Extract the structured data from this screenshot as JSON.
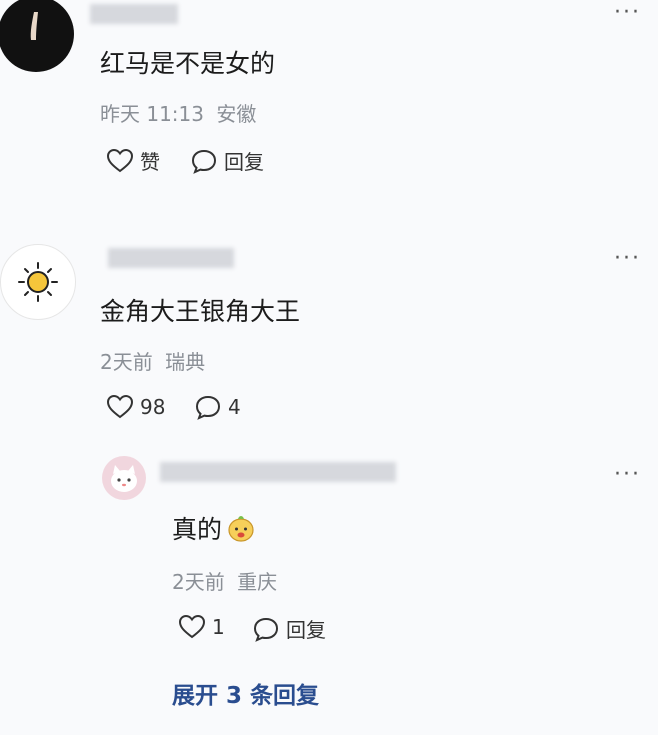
{
  "comments": [
    {
      "content": "红马是不是女的",
      "time": "昨天 11:13",
      "location": "安徽",
      "like_label": "赞",
      "reply_label": "回复"
    },
    {
      "content": "金角大王银角大王",
      "time": "2天前",
      "location": "瑞典",
      "like_count": "98",
      "reply_count": "4",
      "reply": {
        "content": "真的",
        "emoji": "hamster-emoji",
        "time": "2天前",
        "location": "重庆",
        "like_count": "1",
        "reply_label": "回复"
      },
      "expand_label": "展开 3 条回复"
    }
  ],
  "more_glyph": "···"
}
